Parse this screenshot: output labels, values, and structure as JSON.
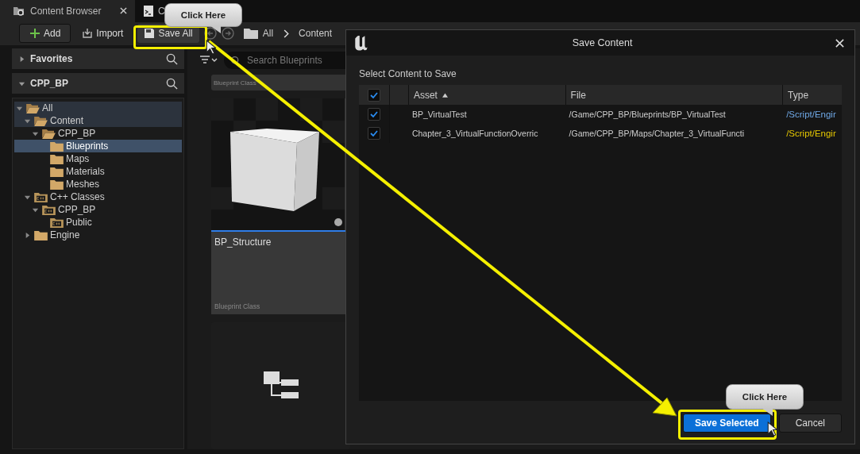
{
  "tabs": [
    {
      "label": "Content Browser",
      "selected": true,
      "closable": true,
      "kind": "browser"
    },
    {
      "label": "C",
      "selected": false,
      "closable": false,
      "kind": "console"
    }
  ],
  "toolbar": {
    "add": "Add",
    "import": "Import",
    "save_all": "Save All",
    "breadcrumb": [
      "All",
      "Content"
    ]
  },
  "sidebar": {
    "sections": [
      {
        "title": "Favorites",
        "expanded": false
      },
      {
        "title": "CPP_BP",
        "expanded": true
      }
    ],
    "tree": [
      {
        "label": "All",
        "kind": "folder",
        "expanded": true,
        "selected": false,
        "children": [
          {
            "label": "Content",
            "kind": "folder",
            "expanded": true,
            "selected": false,
            "children": [
              {
                "label": "CPP_BP",
                "kind": "folder",
                "expanded": true,
                "selected": false,
                "children": [
                  {
                    "label": "Blueprints",
                    "kind": "folder",
                    "selected": true
                  },
                  {
                    "label": "Maps",
                    "kind": "folder",
                    "selected": false
                  },
                  {
                    "label": "Materials",
                    "kind": "folder",
                    "selected": false
                  },
                  {
                    "label": "Meshes",
                    "kind": "folder",
                    "selected": false
                  }
                ]
              }
            ]
          },
          {
            "label": "C++ Classes",
            "kind": "cpp",
            "expanded": true,
            "selected": false,
            "children": [
              {
                "label": "CPP_BP",
                "kind": "cpp",
                "expanded": true,
                "selected": false,
                "children": [
                  {
                    "label": "Public",
                    "kind": "cpp",
                    "selected": false
                  }
                ]
              }
            ]
          },
          {
            "label": "Engine",
            "kind": "folder",
            "expanded": false,
            "selected": false
          }
        ]
      }
    ]
  },
  "assets": {
    "search": {
      "placeholder": "Search Blueprints"
    },
    "tiles": [
      {
        "kind": "partial",
        "type": "Blueprint Class"
      },
      {
        "kind": "cube",
        "name": "BP_Structure",
        "type": "Blueprint Class",
        "selected": true
      },
      {
        "kind": "hierarchy"
      }
    ]
  },
  "dialog": {
    "title": "Save Content",
    "prompt": "Select Content to Save",
    "select_all": {
      "checked": true
    },
    "columns": [
      "Asset",
      "File",
      "Type"
    ],
    "rows": [
      {
        "checked": true,
        "asset": "BP_VirtualTest",
        "file": "/Game/CPP_BP/Blueprints/BP_VirtualTest",
        "type": "/Script/Engir",
        "color": "#6fa8e6"
      },
      {
        "checked": true,
        "asset": "Chapter_3_VirtualFunctionOverric",
        "file": "/Game/CPP_BP/Maps/Chapter_3_VirtualFuncti",
        "type": "/Script/Engir",
        "color": "#e6c800"
      }
    ],
    "buttons": [
      {
        "label": "Save Selected",
        "primary": true
      },
      {
        "label": "Cancel",
        "primary": false
      }
    ]
  },
  "callouts": [
    {
      "text": "Click Here"
    },
    {
      "text": "Click Here"
    }
  ]
}
